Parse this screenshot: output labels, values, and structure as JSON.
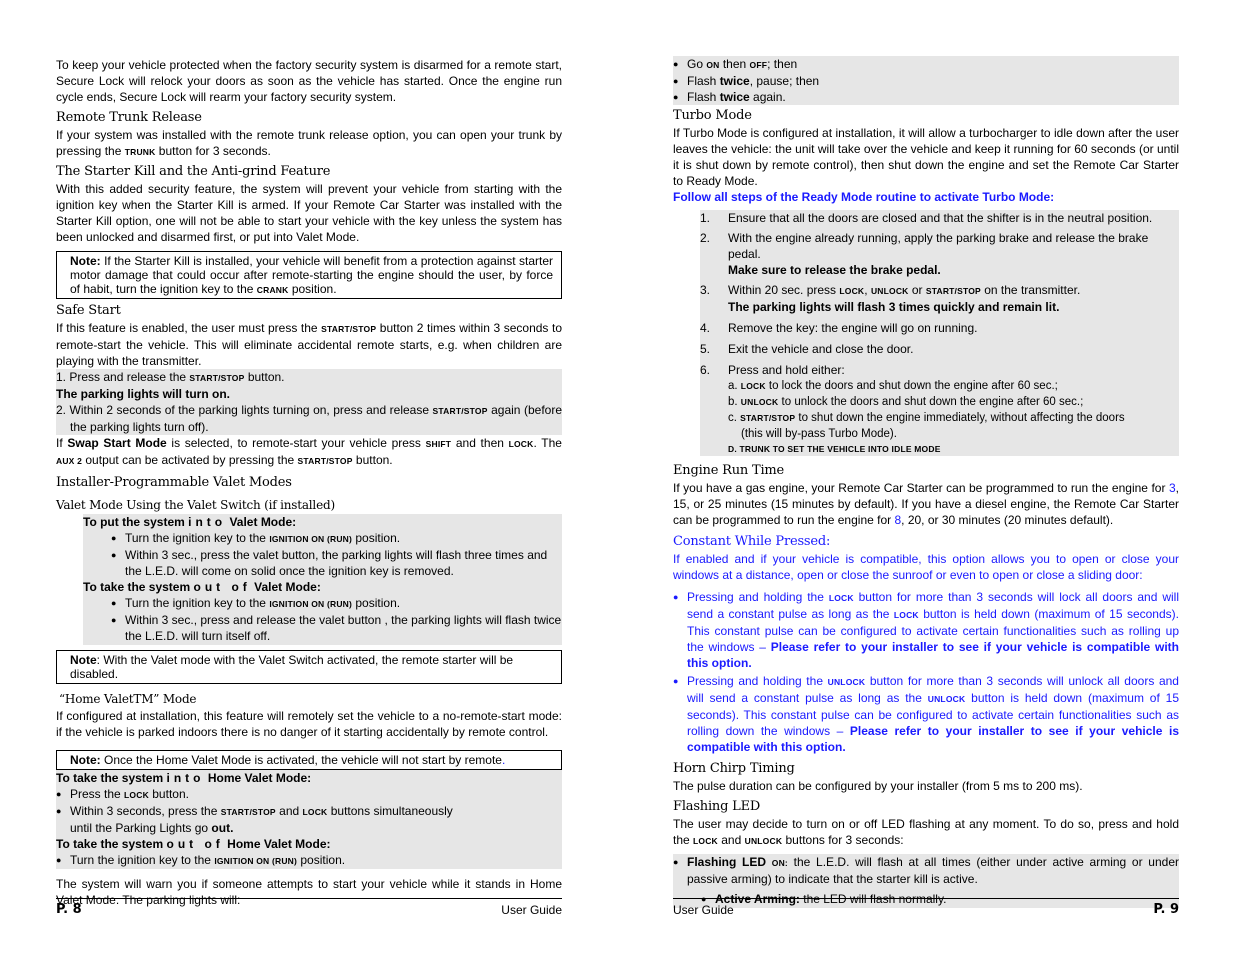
{
  "left_page": {
    "intro": "To keep your vehicle protected when the factory security system is disarmed for a remote start, Secure Lock will relock your doors as soon as the vehicle has started. Once the engine run cycle ends, Secure Lock will rearm your factory security system.",
    "trunk": {
      "heading": "Remote Trunk Release",
      "text_a": "If your system was installed with the remote trunk release option, you can open your trunk by pressing the ",
      "key": "TRUNK",
      "text_b": " button for 3 seconds."
    },
    "starter_kill": {
      "heading": "The Starter Kill and the Anti-grind Feature",
      "text": "With this added security feature, the system will prevent your vehicle from starting with the ignition key when the Starter Kill is armed. If your Remote Car Starter was installed with the Starter Kill option, one will not be able to start your vehicle with the key unless the system has been unlocked and disarmed first, or put into Valet Mode.",
      "note_label": "Note:",
      "note_a": " If the Starter Kill is installed, your vehicle will benefit from a protection against starter motor damage that could occur after remote-starting the engine should the user, by force of habit, turn the ignition key to the ",
      "note_key": "CRANK",
      "note_b": " position."
    },
    "safe_start": {
      "heading": "Safe Start",
      "text_a": "If this feature is enabled, the user must press the ",
      "key": "START/STOP",
      "text_b": " button 2 times within 3 seconds to remote-start the vehicle. This will eliminate accidental remote starts, e.g. when children are playing with the transmitter.",
      "step1_a": "1. Press and release the ",
      "step1_b": " button.",
      "step1_result": "The parking lights will turn on.",
      "step2_a": "2. Within 2 seconds of the parking lights turning on, press and release ",
      "step2_b": " again (before the parking lights turn off).",
      "swap_a": "If ",
      "swap_bold": "Swap Start Mode",
      "swap_b": " is selected, to remote-start your vehicle press ",
      "shift_key": "SHIFT",
      "swap_c": " and then ",
      "lock_key": "LOCK",
      "swap_d": ". The ",
      "aux_key": "AUX 2",
      "swap_e": " output can be activated by pressing the ",
      "swap_f": " button."
    },
    "valet": {
      "heading": "Installer-Programmable Valet Modes",
      "subheading": "Valet Mode Using the Valet Switch (if installed)",
      "into_a": "To put the system ",
      "into_spaced": "into",
      "into_b": " Valet Mode:",
      "into_bullet1_a": "Turn the ignition key to the ",
      "ign_key": "IGNITION ON (RUN)",
      "into_bullet1_b": " position.",
      "into_bullet2": "Within 3 sec., press the valet button, the parking lights will flash three times and the L.E.D. will come on solid once the ignition key is removed.",
      "out_a": "To take the system ",
      "out_spaced": "out of",
      "out_b": " Valet Mode:",
      "out_bullet1_a": "Turn the ignition key to the ",
      "out_bullet1_b": " position.",
      "out_bullet2": "Within 3 sec., press and release the valet button , the parking lights will flash twice the L.E.D. will turn itself off.",
      "note_label": "Note",
      "note_text": ": With the Valet mode with the Valet Switch activated, the remote starter will be disabled."
    },
    "home_valet": {
      "heading": "“Home ValetTM” Mode",
      "text": "If configured at installation, this feature will remotely set the vehicle to a no-remote-start mode: if the vehicle is parked indoors there is no danger of it starting accidentally by remote control.",
      "note_label": "Note:",
      "note_text": " Once the Home Valet Mode is activated, the vehicle will not start by remote",
      "note_dot": ".",
      "into_a": "To take the system ",
      "into_spaced": "into",
      "into_b": " Home Valet Mode:",
      "b1_a": "Press the ",
      "lock_key": "LOCK",
      "b1_b": " button.",
      "b2_a": "Within 3 seconds, press the ",
      "ss_key": "START/STOP",
      "b2_b": " and ",
      "b2_c": " buttons simultaneously",
      "b2_d": "until the Parking Lights go ",
      "b2_bold": "out.",
      "out_a": "To take the system ",
      "out_spaced": "out of",
      "out_b": " Home Valet Mode:",
      "b3_a": "Turn the ignition key to the ",
      "ign_key": "IGNITION ON (RUN)",
      "b3_b": " position.",
      "warn": "The system will warn you if someone attempts to start your vehicle while it stands in Home Valet Mode. The parking lights will:"
    },
    "footer": {
      "page": "P. 8",
      "title": "User Guide"
    }
  },
  "right_page": {
    "warn_list": {
      "b1_a": "Go ",
      "on": "ON",
      "b1_b": " then ",
      "off": "OFF",
      "b1_c": "; then",
      "b2_a": "Flash ",
      "twice": "twice",
      "b2_b": ", pause; then",
      "b3_a": "Flash ",
      "b3_b": " again."
    },
    "turbo": {
      "heading": "Turbo Mode",
      "text": "If Turbo Mode is configured at installation, it will allow a turbocharger to idle down after the user leaves the vehicle: the unit will take over the vehicle and keep it running for 60 seconds (or until it is shut down by remote control), then shut down the engine and set the Remote Car Starter to Ready Mode.",
      "blue_line": "Follow all steps of the Ready Mode routine to activate Turbo Mode:",
      "steps": [
        {
          "n": "1.",
          "text": "Ensure that all the doors are closed and that the shifter is in the neutral position."
        },
        {
          "n": "2.",
          "text": "With the engine already running, apply the parking brake and release the brake pedal.",
          "bold": "Make sure to release the brake pedal."
        },
        {
          "n": "3.",
          "text_a": "Within 20 sec. press ",
          "k1": "LOCK",
          "sep1": ", ",
          "k2": "UNLOCK",
          "sep2": " or ",
          "k3": "START/STOP",
          "text_b": " on the transmitter.",
          "bold": "The parking lights will flash 3 times quickly and remain lit."
        },
        {
          "n": "4.",
          "text": "Remove the key: the engine will go on running."
        },
        {
          "n": "5.",
          "text": "Exit the vehicle and close the door."
        },
        {
          "n": "6.",
          "text": "Press and hold either:"
        }
      ],
      "sub": {
        "a_pre": "a. ",
        "a_key": "LOCK",
        "a_text": " to lock the doors and shut down the engine after 60 sec.;",
        "b_pre": "b. ",
        "b_key": "UNLOCK",
        "b_text": " to unlock the doors and shut down the engine after 60 sec.;",
        "c_pre": "c. ",
        "c_key": "START/STOP",
        "c_text": " to shut down the engine immediately, without affecting the doors",
        "c_text2": "(this will by-pass Turbo Mode).",
        "d_text": "D. TRUNK TO SET THE VEHICLE INTO IDLE MODE"
      }
    },
    "engine_run": {
      "heading": "Engine Run Time",
      "t1": "If you have a gas engine, your Remote Car Starter can be programmed to run the engine for ",
      "v1": "3",
      "t2": ", 15, or 25 minutes (15 minutes by default). If you have a diesel engine, the Remote Car Starter can be programmed to run the engine for ",
      "v2": "8",
      "t3": ", 20, or 30 minutes (20 minutes default)."
    },
    "constant": {
      "heading": "Constant While Pressed:",
      "text": "If enabled and if your vehicle is compatible, this option allows you to open or close your windows at a distance, open or close the sunroof or even to open or close a sliding door:",
      "b1_a": "Pressing and holding the ",
      "lock_key": "LOCK",
      "b1_b": " button for more than 3 seconds will lock all doors and will send a constant pulse as long as the ",
      "b1_c": " button is held down (maximum of 15 seconds).  This constant pulse can be configured to activate certain functionalities such as rolling up the windows – ",
      "refer": "Please refer to your installer to see if your vehicle is compatible with this option.",
      "b2_a": "Pressing and holding the ",
      "unlock_key": "UNLOCK",
      "b2_b": " button for more than 3 seconds will unlock all doors and will send a constant pulse as long as the ",
      "b2_c": " button is held down (maximum of 15 seconds). This constant pulse can be configured to activate certain functionalities such as rolling down the windows – "
    },
    "horn": {
      "heading": "Horn Chirp Timing",
      "text": "The pulse duration can be configured by your installer (from 5 ms to 200 ms)."
    },
    "led": {
      "heading": "Flashing LED",
      "text_a": "The user may decide to turn on or off LED flashing at any moment. To do so, press and hold the ",
      "lock_key": "LOCK",
      "text_b": " and ",
      "unlock_key": "UNLOCK",
      "text_c": " buttons for 3 seconds:",
      "b1_bold": "Flashing LED ",
      "b1_key": "ON:",
      "b1_text": " the L.E.D. will flash at all times (either under active arming or under passive arming) to indicate that the starter kill is active.",
      "b2_bold": "Active Arming:",
      "b2_text": " the LED will flash normally."
    },
    "footer": {
      "page": "P. 9",
      "title": "User Guide"
    }
  }
}
